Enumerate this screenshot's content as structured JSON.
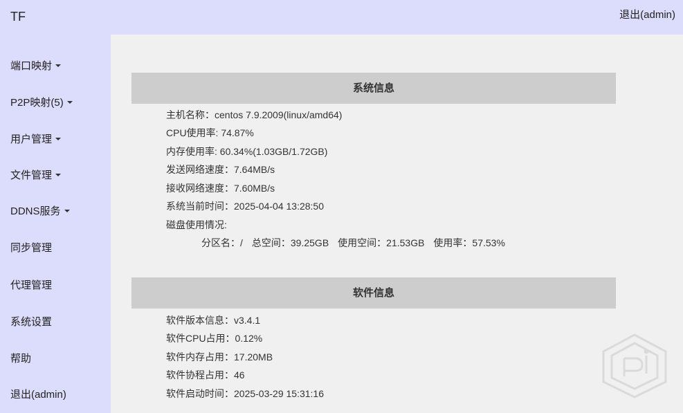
{
  "topbar": {
    "brand": "TF",
    "logout": "退出(admin)"
  },
  "sidebar": {
    "items": [
      {
        "label": "端口映射",
        "dropdown": true
      },
      {
        "label": "P2P映射(5)",
        "dropdown": true
      },
      {
        "label": "用户管理",
        "dropdown": true
      },
      {
        "label": "文件管理",
        "dropdown": true
      },
      {
        "label": "DDNS服务",
        "dropdown": true
      },
      {
        "label": "同步管理",
        "dropdown": false
      },
      {
        "label": "代理管理",
        "dropdown": false
      },
      {
        "label": "系统设置",
        "dropdown": false
      },
      {
        "label": "帮助",
        "dropdown": false
      },
      {
        "label": "退出(admin)",
        "dropdown": false
      }
    ]
  },
  "system_info": {
    "title": "系统信息",
    "hostname": "主机名称：centos 7.9.2009(linux/amd64)",
    "cpu": "CPU使用率: 74.87%",
    "memory": "内存使用率: 60.34%(1.03GB/1.72GB)",
    "send_speed": "发送网络速度：7.64MB/s",
    "recv_speed": "接收网络速度：7.60MB/s",
    "current_time": "系统当前时间：2025-04-04 13:28:50",
    "disk_label": "磁盘使用情况:",
    "disk": {
      "partition": "分区名：/",
      "total": "总空间：39.25GB",
      "used": "使用空间：21.53GB",
      "usage": "使用率：57.53%"
    }
  },
  "software_info": {
    "title": "软件信息",
    "version": "软件版本信息：v3.4.1",
    "cpu": "软件CPU占用：0.12%",
    "memory": "软件内存占用：17.20MB",
    "goroutines": "软件协程占用：46",
    "start_time": "软件启动时间：2025-03-29 15:31:16"
  },
  "watermark": {
    "icon": "tech-logo-watermark"
  }
}
